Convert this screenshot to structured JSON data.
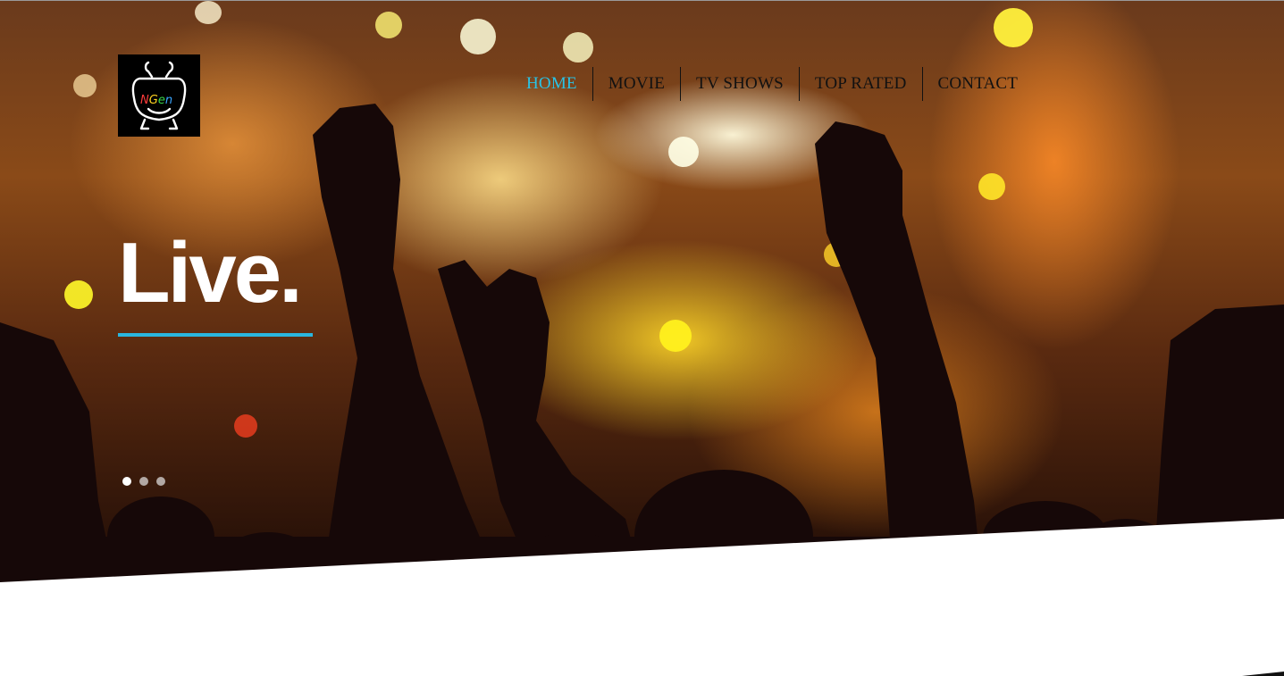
{
  "brand": {
    "logo_text": "NGen"
  },
  "nav": {
    "items": [
      {
        "label": "HOME",
        "active": true
      },
      {
        "label": "MOVIE",
        "active": false
      },
      {
        "label": "TV SHOWS",
        "active": false
      },
      {
        "label": "TOP RATED",
        "active": false
      },
      {
        "label": "CONTACT",
        "active": false
      }
    ]
  },
  "hero": {
    "headline": "Live.",
    "slider": {
      "slide_count": 3,
      "active_index": 0
    }
  },
  "colors": {
    "accent": "#29c3e6",
    "underline": "#29b6df",
    "nav_text": "#111111",
    "headline": "#ffffff"
  }
}
